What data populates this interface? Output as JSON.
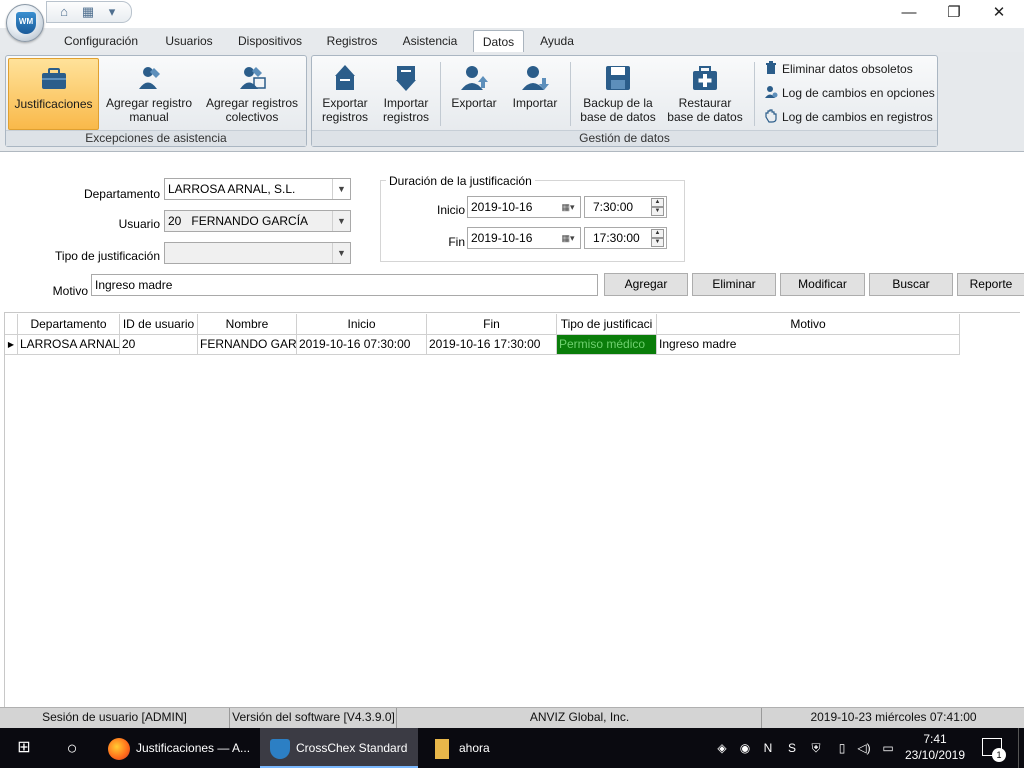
{
  "app": {
    "logo_text": "WM",
    "window_controls": {
      "minimize": "—",
      "maximize": "❐",
      "close": "✕"
    }
  },
  "menu_tabs": [
    {
      "label": "Configuración"
    },
    {
      "label": "Usuarios"
    },
    {
      "label": "Dispositivos"
    },
    {
      "label": "Registros"
    },
    {
      "label": "Asistencia"
    },
    {
      "label": "Datos",
      "active": true
    },
    {
      "label": "Ayuda"
    }
  ],
  "ribbon": {
    "group_exceptions": {
      "label": "Excepciones de asistencia",
      "buttons": [
        {
          "label": "Justificaciones",
          "icon": "briefcase-icon",
          "selected": true
        },
        {
          "label": "Agregar registro manual",
          "icon": "pen-user-icon"
        },
        {
          "label": "Agregar registros colectivos",
          "icon": "multi-pen-user-icon"
        }
      ]
    },
    "group_data": {
      "label": "Gestión de datos",
      "buttons": [
        {
          "label": "Exportar registros",
          "icon": "export-records-icon"
        },
        {
          "label": "Importar registros",
          "icon": "import-records-icon"
        },
        {
          "label": "Exportar",
          "icon": "export-user-icon"
        },
        {
          "label": "Importar",
          "icon": "import-user-icon"
        },
        {
          "label": "Backup de la base de datos",
          "icon": "floppy-icon"
        },
        {
          "label": "Restaurar base de datos",
          "icon": "first-aid-icon"
        }
      ],
      "small_buttons": [
        {
          "label": "Eliminar datos obsoletos",
          "icon": "trash-icon"
        },
        {
          "label": "Log de cambios en opciones",
          "icon": "user-gear-icon"
        },
        {
          "label": "Log de cambios en registros",
          "icon": "hand-log-icon"
        }
      ]
    }
  },
  "form": {
    "departamento_label": "Departamento",
    "departamento_value": "LARROSA ARNAL, S.L.",
    "usuario_label": "Usuario",
    "usuario_id": "20",
    "usuario_name": "FERNANDO GARCÍA",
    "tipo_label": "Tipo de justificación",
    "tipo_value": "",
    "motivo_label": "Motivo",
    "motivo_value": "Ingreso madre",
    "duracion_legend": "Duración de la justificación",
    "inicio_label": "Inicio",
    "inicio_date": "2019-10-16",
    "inicio_time": "7:30:00",
    "fin_label": "Fin",
    "fin_date": "2019-10-16",
    "fin_time": "17:30:00",
    "buttons": {
      "agregar": "Agregar",
      "eliminar": "Eliminar",
      "modificar": "Modificar",
      "buscar": "Buscar",
      "reporte": "Reporte"
    }
  },
  "grid": {
    "columns": [
      "Departamento",
      "ID de usuario",
      "Nombre",
      "Inicio",
      "Fin",
      "Tipo de justificaci",
      "Motivo"
    ],
    "rows": [
      {
        "departamento": "LARROSA ARNAL,",
        "id": "20",
        "nombre": "FERNANDO GARC",
        "inicio": "2019-10-16 07:30:00",
        "fin": "2019-10-16 17:30:00",
        "tipo": "Permiso médico",
        "motivo": "Ingreso madre"
      }
    ],
    "tipo_color": "#0a7d0a"
  },
  "status": {
    "session": "Sesión de usuario  [ADMIN]",
    "version": "Versión del software  [V4.3.9.0]",
    "company": "ANVIZ Global, Inc.",
    "datetime": "2019-10-23 miércoles 07:41:00"
  },
  "taskbar": {
    "items": [
      {
        "label": "Justificaciones — A...",
        "icon": "firefox-icon"
      },
      {
        "label": "CrossChex Standard",
        "icon": "crosschex-icon",
        "active": true
      },
      {
        "label": "ahora",
        "icon": "folder-icon"
      }
    ],
    "clock_time": "7:41",
    "clock_date": "23/10/2019",
    "notification_count": "1"
  }
}
